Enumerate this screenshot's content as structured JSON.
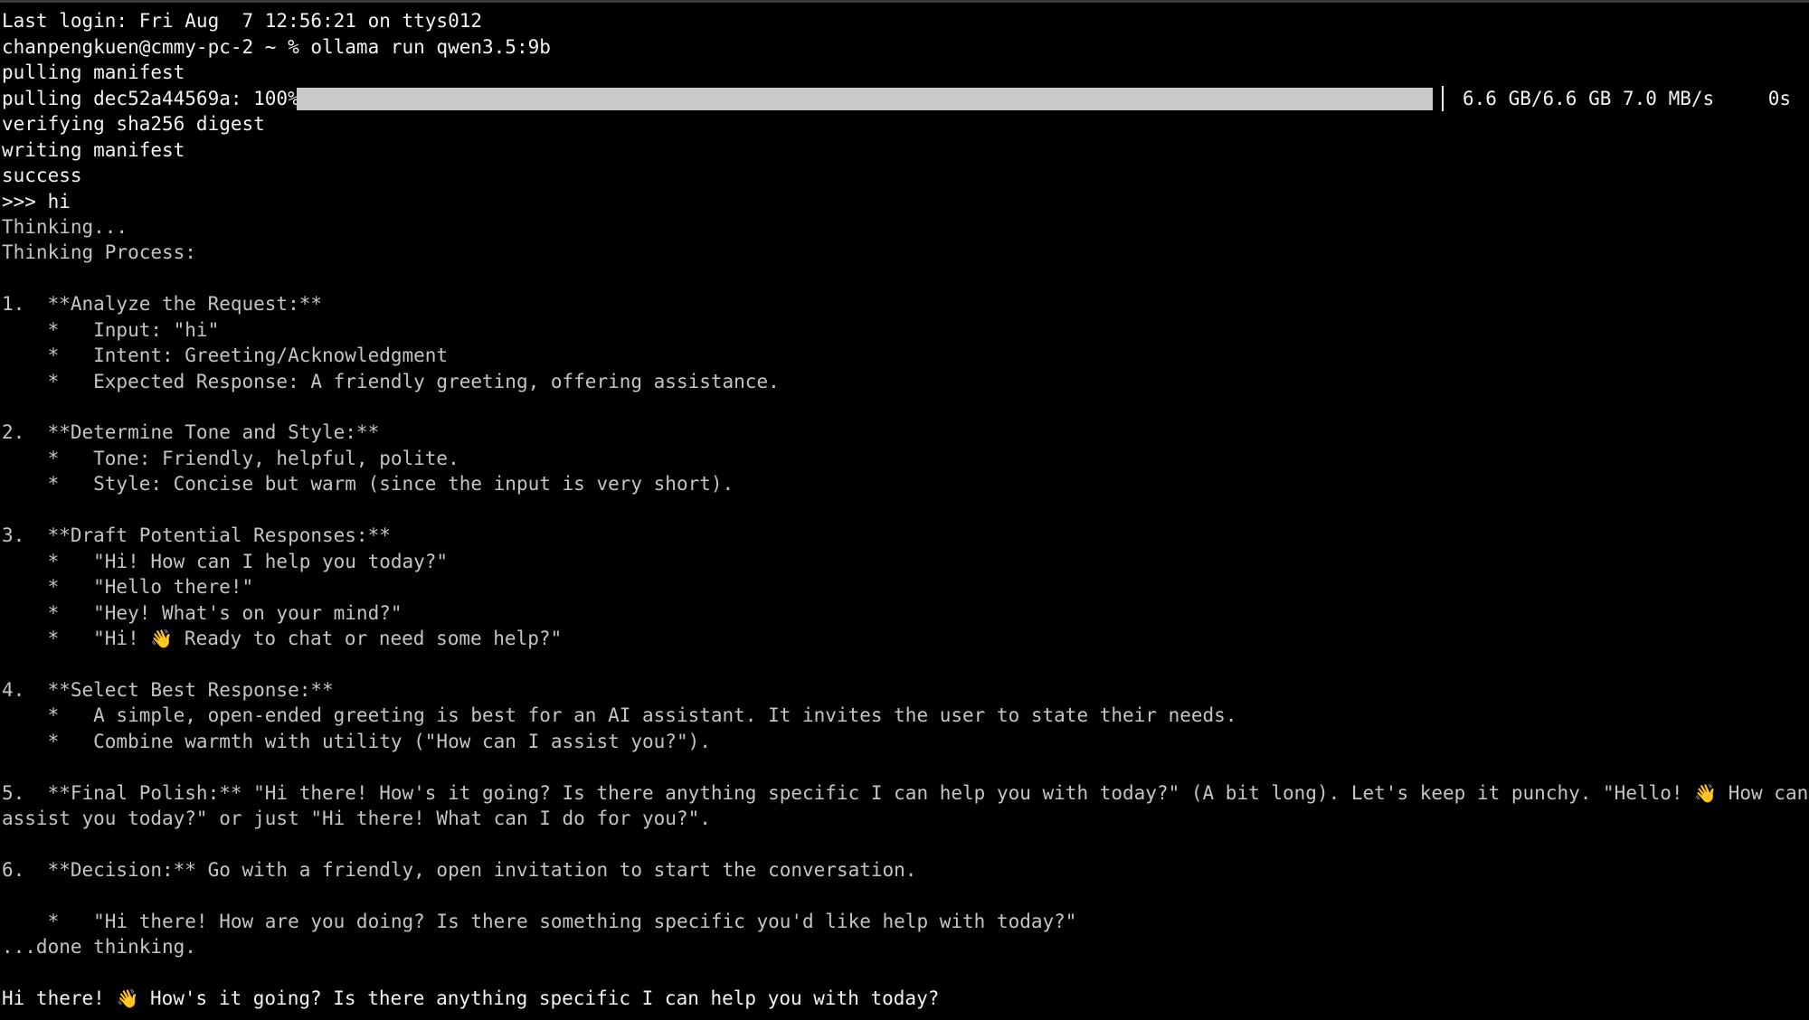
{
  "terminal": {
    "last_login": "Last login: Fri Aug  7 12:56:21 on ttys012",
    "prompt_line": "chanpengkuen@cmmy-pc-2 ~ % ollama run qwen3.5:9b",
    "pulling_manifest": "pulling manifest",
    "progress": {
      "label": "pulling dec52a44569a: 100%",
      "fraction": 1.0,
      "size": "6.6 GB/6.6 GB",
      "speed": "7.0 MB/s",
      "eta": "0s"
    },
    "verifying": "verifying sha256 digest",
    "writing": "writing manifest",
    "success": "success",
    "user_input": ">>> hi",
    "thinking": "Thinking...",
    "thinking_process": "Thinking Process:",
    "steps": {
      "s1": "1.  **Analyze the Request:**",
      "s1a": "    *   Input: \"hi\"",
      "s1b": "    *   Intent: Greeting/Acknowledgment",
      "s1c": "    *   Expected Response: A friendly greeting, offering assistance.",
      "s2": "2.  **Determine Tone and Style:**",
      "s2a": "    *   Tone: Friendly, helpful, polite.",
      "s2b": "    *   Style: Concise but warm (since the input is very short).",
      "s3": "3.  **Draft Potential Responses:**",
      "s3a": "    *   \"Hi! How can I help you today?\"",
      "s3b": "    *   \"Hello there!\"",
      "s3c": "    *   \"Hey! What's on your mind?\"",
      "s3d_pre": "    *   \"Hi! ",
      "s3d_emoji": "👋",
      "s3d_post": " Ready to chat or need some help?\"",
      "s4": "4.  **Select Best Response:**",
      "s4a": "    *   A simple, open-ended greeting is best for an AI assistant. It invites the user to state their needs.",
      "s4b": "    *   Combine warmth with utility (\"How can I assist you?\").",
      "s5_pre": "5.  **Final Polish:** \"Hi there! How's it going? Is there anything specific I can help you with today?\" (A bit long). Let's keep it punchy. \"Hello! ",
      "s5_emoji": "👋",
      "s5_post": " How can I",
      "s5_cont": "assist you today?\" or just \"Hi there! What can I do for you?\".",
      "s6": "6.  **Decision:** Go with a friendly, open invitation to start the conversation.",
      "s6a": "    *   \"Hi there! How are you doing? Is there something specific you'd like help with today?\""
    },
    "done_thinking": "...done thinking.",
    "final_pre": "Hi there! ",
    "final_emoji": "👋",
    "final_post": " How's it going? Is there anything specific I can help you with today?"
  }
}
